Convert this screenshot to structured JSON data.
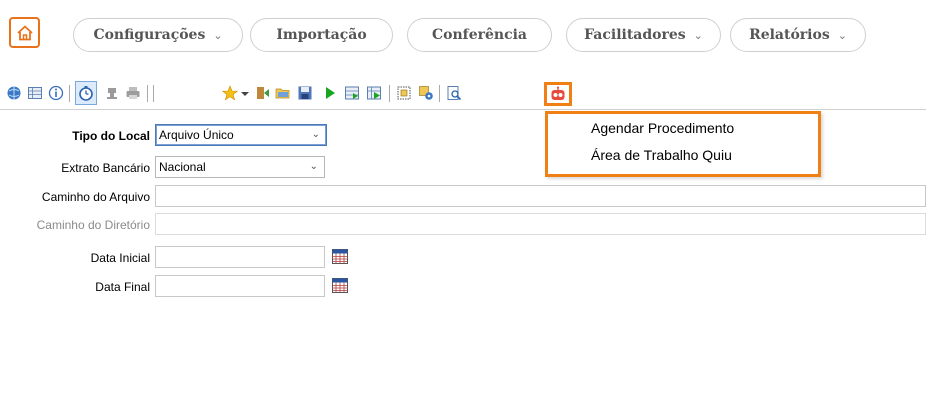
{
  "nav": {
    "home_icon": "home-icon",
    "items": [
      {
        "label": "Configurações",
        "has_dropdown": true
      },
      {
        "label": "Importação",
        "has_dropdown": false
      },
      {
        "label": "Conferência",
        "has_dropdown": false
      },
      {
        "label": "Facilitadores",
        "has_dropdown": true
      },
      {
        "label": "Relatórios",
        "has_dropdown": true
      }
    ],
    "chevron": "⌄"
  },
  "toolbar": {
    "icons": [
      "web-icon",
      "grid-icon",
      "info-icon",
      "timer-icon",
      "stamp-icon",
      "print-icon",
      "favorite-star-icon",
      "star-dropdown-icon",
      "exit-icon",
      "open-folder-icon",
      "save-icon",
      "play-icon",
      "run-list-icon",
      "run-grid-icon",
      "select-all-icon",
      "config-icon",
      "preview-icon",
      "robot-icon"
    ],
    "highlighted_icon": "robot-icon"
  },
  "menu": {
    "items": [
      {
        "label": "Agendar Procedimento"
      },
      {
        "label": "Área de Trabalho Quiu"
      }
    ],
    "highlight_color": "#f07f14"
  },
  "form": {
    "tipo_local": {
      "label": "Tipo do Local",
      "value": "Arquivo Único"
    },
    "extrato": {
      "label": "Extrato Bancário",
      "value": "Nacional"
    },
    "caminho_arquivo": {
      "label": "Caminho do Arquivo",
      "value": ""
    },
    "caminho_diretorio": {
      "label": "Caminho do Diretório",
      "value": ""
    },
    "data_inicial": {
      "label": "Data Inicial",
      "value": ""
    },
    "data_final": {
      "label": "Data Final",
      "value": ""
    },
    "select_arrow": "⌄"
  },
  "colors": {
    "accent": "#e8731c",
    "highlight": "#f07f14"
  }
}
